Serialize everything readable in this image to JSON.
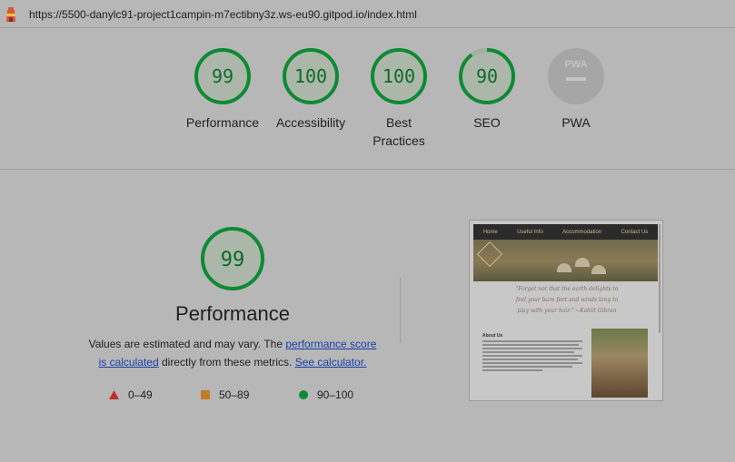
{
  "url_bar": {
    "url": "https://5500-danylc91-project1campin-m7ectibny3z.ws-eu90.gitpod.io/index.html"
  },
  "colors": {
    "pass": "#0c8a34",
    "pass_fill": "#acb7a9",
    "average": "#c27c2a",
    "fail": "#c0302b",
    "pwa_grey": "#a6a6a6",
    "link": "#1a3fa8"
  },
  "scores": [
    {
      "id": "performance",
      "value": "99",
      "score": 99,
      "label": "Performance"
    },
    {
      "id": "accessibility",
      "value": "100",
      "score": 100,
      "label": "Accessibility"
    },
    {
      "id": "best-practices",
      "value": "100",
      "score": 100,
      "label_line1": "Best",
      "label_line2": "Practices"
    },
    {
      "id": "seo",
      "value": "90",
      "score": 90,
      "label": "SEO"
    },
    {
      "id": "pwa",
      "badge": "PWA",
      "label": "PWA"
    }
  ],
  "performance_detail": {
    "score": "99",
    "score_value": 99,
    "title": "Performance",
    "desc_part1": "Values are estimated and may vary. The ",
    "link1_line1": "performance score",
    "link1_line2": "is calculated",
    "desc_part2": " directly from these metrics. ",
    "link2": "See calculator."
  },
  "legend": [
    {
      "icon": "triangle-icon",
      "range": "0–49"
    },
    {
      "icon": "square-icon",
      "range": "50–89"
    },
    {
      "icon": "circle-icon",
      "range": "90–100"
    }
  ],
  "screenshot_thumb": {
    "nav": [
      "Home",
      "Useful Info",
      "Accommodation",
      "Contact Us"
    ],
    "quote_line1": "\"Forget not that the earth delights to",
    "quote_line2": "feel your bare feet and winds long to",
    "quote_line3": "play with your hair.\" ~Kahlil Gibran",
    "about_title": "About Us"
  }
}
